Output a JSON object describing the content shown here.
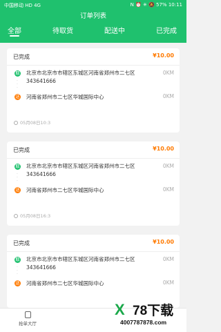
{
  "status_bar": {
    "carrier": "中国移动 HD 4G",
    "indicators": "N ⏰ ✳ 🔕 57%",
    "time": "10:11"
  },
  "header": {
    "title": "订单列表"
  },
  "tabs": [
    {
      "label": "全部",
      "active": true
    },
    {
      "label": "待取货",
      "active": false
    },
    {
      "label": "配送中",
      "active": false
    },
    {
      "label": "已完成",
      "active": false
    }
  ],
  "orders": [
    {
      "status": "已完成",
      "price": "¥10.00",
      "pickup_badge": "取",
      "pickup_address": "北京市北京市市辖区东城区河南省郑州市二七区343641666",
      "pickup_distance": "0KM",
      "delivery_badge": "送",
      "delivery_address": "河南省郑州市二七区华城国际中心",
      "delivery_distance": "0KM",
      "time": "05月08日10:3"
    },
    {
      "status": "已完成",
      "price": "¥10.00",
      "pickup_badge": "取",
      "pickup_address": "北京市北京市市辖区东城区河南省郑州市二七区343641666",
      "pickup_distance": "0KM",
      "delivery_badge": "送",
      "delivery_address": "河南省郑州市二七区华城国际中心",
      "delivery_distance": "0KM",
      "time": "05月08日16:3"
    },
    {
      "status": "已完成",
      "price": "¥10.00",
      "pickup_badge": "取",
      "pickup_address": "北京市北京市市辖区东城区河南省郑州市二七区343641666",
      "pickup_distance": "0KM",
      "delivery_badge": "送",
      "delivery_address": "河南省郑州市二七区华城国际中心",
      "delivery_distance": "0KM",
      "time": ""
    }
  ],
  "bottom_nav": {
    "hall_label": "抢单大厅",
    "hall_icon": "clipboard-icon"
  },
  "watermark": {
    "logo": "X",
    "brand": "78下载",
    "url": "4007787878.com"
  },
  "colors": {
    "primary": "#1fc16e",
    "price": "#ff7a00",
    "delivery_badge": "#ff7a00"
  }
}
